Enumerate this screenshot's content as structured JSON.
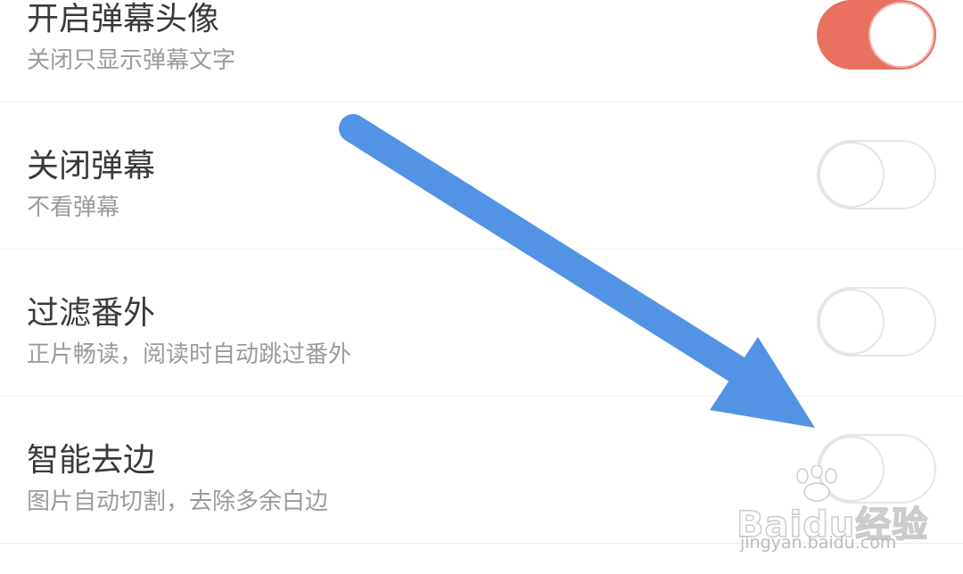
{
  "settings": {
    "items": [
      {
        "title": "开启弹幕头像",
        "subtitle": "关闭只显示弹幕文字",
        "enabled": true
      },
      {
        "title": "关闭弹幕",
        "subtitle": "不看弹幕",
        "enabled": false
      },
      {
        "title": "过滤番外",
        "subtitle": "正片畅读，阅读时自动跳过番外",
        "enabled": false
      },
      {
        "title": "智能去边",
        "subtitle": "图片自动切割，去除多余白边",
        "enabled": false
      }
    ]
  },
  "watermark": {
    "brand": "Baidu经验",
    "url": "jingyan.baidu.com"
  },
  "colors": {
    "toggle_on": "#e97160",
    "arrow": "#5393e4",
    "title_text": "#3a3a3a",
    "subtitle_text": "#9b9b9b",
    "divider": "#ededed"
  },
  "icons": {
    "annotation": "arrow-pointer-icon",
    "watermark": "baidu-paw-icon"
  }
}
